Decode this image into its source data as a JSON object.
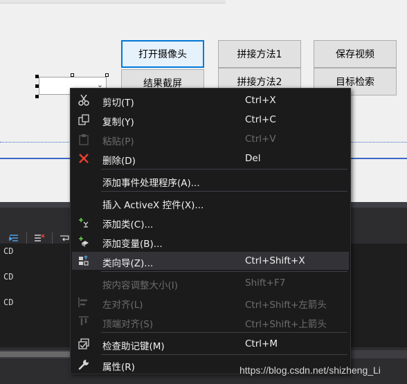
{
  "design": {
    "buttons": {
      "open_camera": "打开摄像头",
      "splice1": "拼接方法1",
      "save_video": "保存视频",
      "result_capture": "结果截屏",
      "splice2": "拼接方法2",
      "target_search": "目标检索"
    },
    "combo_arrow": "⌄"
  },
  "output": {
    "lines": [
      "CD",
      "CD",
      "CD"
    ]
  },
  "context_menu": {
    "items": [
      {
        "label": "剪切(T)",
        "shortcut": "Ctrl+X",
        "icon": "scissors-icon",
        "enabled": true
      },
      {
        "label": "复制(Y)",
        "shortcut": "Ctrl+C",
        "icon": "copy-icon",
        "enabled": true
      },
      {
        "label": "粘贴(P)",
        "shortcut": "Ctrl+V",
        "icon": "paste-icon",
        "enabled": false
      },
      {
        "label": "删除(D)",
        "shortcut": "Del",
        "icon": "delete-icon",
        "enabled": true
      },
      {
        "label": "添加事件处理程序(A)...",
        "shortcut": "",
        "icon": "",
        "enabled": true
      },
      {
        "label": "插入 ActiveX 控件(X)...",
        "shortcut": "",
        "icon": "",
        "enabled": true
      },
      {
        "label": "添加类(C)...",
        "shortcut": "",
        "icon": "add-class-icon",
        "enabled": true
      },
      {
        "label": "添加变量(B)...",
        "shortcut": "",
        "icon": "add-variable-icon",
        "enabled": true
      },
      {
        "label": "类向导(Z)...",
        "shortcut": "Ctrl+Shift+X",
        "icon": "class-wizard-icon",
        "enabled": true,
        "highlighted": true
      },
      {
        "label": "按内容调整大小(I)",
        "shortcut": "Shift+F7",
        "icon": "",
        "enabled": false
      },
      {
        "label": "左对齐(L)",
        "shortcut": "Ctrl+Shift+左箭头",
        "icon": "align-left-icon",
        "enabled": false
      },
      {
        "label": "顶端对齐(S)",
        "shortcut": "Ctrl+Shift+上箭头",
        "icon": "align-top-icon",
        "enabled": false
      },
      {
        "label": "检查助记键(M)",
        "shortcut": "Ctrl+M",
        "icon": "check-mnemonics-icon",
        "enabled": true
      },
      {
        "label": "属性(R)",
        "shortcut": "",
        "icon": "wrench-icon",
        "enabled": true
      }
    ]
  },
  "watermark": "https://blog.csdn.net/shizheng_Li",
  "colors": {
    "menu_bg": "#1b1b1c",
    "menu_highlight": "#333337",
    "menu_text": "#f1f1f1",
    "menu_disabled_text": "#6d6d6d",
    "delete_icon": "#e8412f",
    "focus_border": "#0078d7"
  }
}
